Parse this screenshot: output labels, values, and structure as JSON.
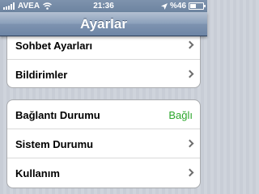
{
  "status_bar": {
    "carrier": "AVEA",
    "time": "21:36",
    "battery_text": "%46",
    "battery_level": 0.46,
    "signal_bars": 5
  },
  "nav_bar": {
    "title": "Ayarlar"
  },
  "group1": {
    "rows": [
      {
        "label": "Sohbet Ayarları",
        "icon": "chevron-right-icon"
      },
      {
        "label": "Bildirimler",
        "icon": "chevron-right-icon"
      }
    ]
  },
  "group2": {
    "rows": [
      {
        "label": "Bağlantı Durumu",
        "value": "Bağlı",
        "value_color": "#2ba62b"
      },
      {
        "label": "Sistem Durumu",
        "icon": "chevron-right-icon"
      },
      {
        "label": "Kullanım",
        "icon": "chevron-right-icon"
      }
    ]
  }
}
